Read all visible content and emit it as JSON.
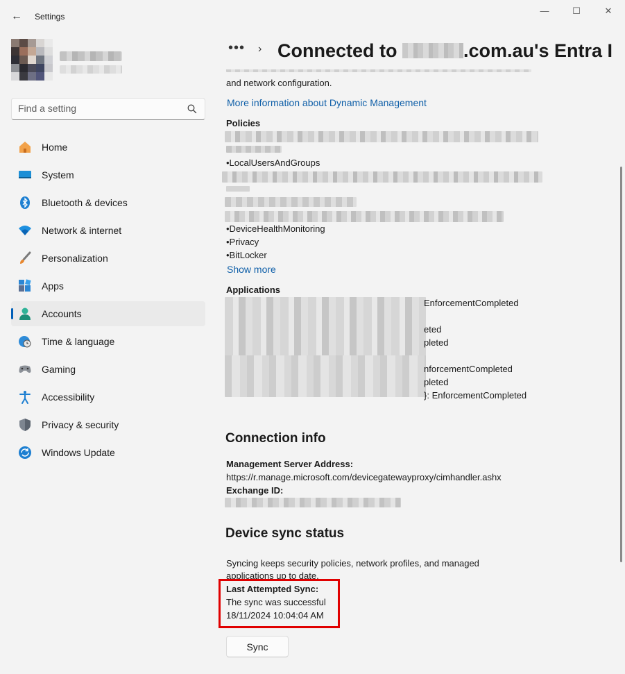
{
  "window": {
    "title": "Settings",
    "back_label": "←",
    "minimize_label": "—",
    "maximize_label": "☐",
    "close_label": "✕"
  },
  "search": {
    "placeholder": "Find a setting"
  },
  "sidebar": {
    "items": [
      {
        "label": "Home",
        "icon": "home-icon"
      },
      {
        "label": "System",
        "icon": "system-icon"
      },
      {
        "label": "Bluetooth & devices",
        "icon": "bluetooth-icon"
      },
      {
        "label": "Network & internet",
        "icon": "wifi-icon"
      },
      {
        "label": "Personalization",
        "icon": "brush-icon"
      },
      {
        "label": "Apps",
        "icon": "apps-icon"
      },
      {
        "label": "Accounts",
        "icon": "accounts-icon",
        "active": true
      },
      {
        "label": "Time & language",
        "icon": "globe-clock-icon"
      },
      {
        "label": "Gaming",
        "icon": "gamepad-icon"
      },
      {
        "label": "Accessibility",
        "icon": "accessibility-icon"
      },
      {
        "label": "Privacy & security",
        "icon": "shield-icon"
      },
      {
        "label": "Windows Update",
        "icon": "update-icon"
      }
    ]
  },
  "header": {
    "dots": "•••",
    "chevron": "›",
    "title_prefix": "Connected to ",
    "title_suffix": ".com.au's Entra I"
  },
  "main": {
    "intro_tail": "and network configuration.",
    "more_info_link": "More information about Dynamic Management",
    "policies": {
      "heading": "Policies",
      "items": [
        "•LocalUsersAndGroups",
        "•DeviceHealthMonitoring",
        "•Privacy",
        "•BitLocker"
      ],
      "show_more": "Show more"
    },
    "applications": {
      "heading": "Applications",
      "lines": [
        "EnforcementCompleted",
        "eted",
        "pleted",
        "nforcementCompleted",
        "pleted",
        "}: EnforcementCompleted"
      ]
    },
    "connection_info": {
      "heading": "Connection info",
      "server_label": "Management Server Address:",
      "server_value": "https://r.manage.microsoft.com/devicegatewayproxy/cimhandler.ashx",
      "exchange_label": "Exchange ID:"
    },
    "sync": {
      "heading": "Device sync status",
      "desc_line1": "Syncing keeps security policies, network profiles, and managed",
      "desc_line2": "applications up to date.",
      "last_label": "Last Attempted Sync:",
      "status": "The sync was successful",
      "timestamp": "18/11/2024 10:04:04 AM",
      "button": "Sync"
    }
  },
  "colors": {
    "accent": "#005fb8",
    "link": "#0f5fa8",
    "highlight": "#e00000",
    "background": "#f3f3f3"
  }
}
